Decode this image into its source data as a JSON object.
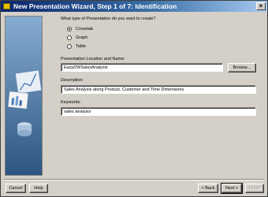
{
  "window": {
    "title": "New Presentation Wizard, Step 1 of 7: Identification",
    "close_label": "×"
  },
  "question": "What type of Presentation do you want to create?",
  "options": [
    {
      "label": "Crosstab",
      "checked": true
    },
    {
      "label": "Graph",
      "checked": false
    },
    {
      "label": "Table",
      "checked": false
    }
  ],
  "location": {
    "label": "Presentation Location and Name:",
    "value": "EasyDWSalesAnalysis",
    "browse_label": "Browse..."
  },
  "description": {
    "label": "Description:",
    "value": "Sales Analysis along  Product, Customer and Time Dimensions"
  },
  "keywords": {
    "label": "Keywords:",
    "value": "sales analysis"
  },
  "footer": {
    "cancel": "Cancel",
    "help": "Help",
    "back": "< Back",
    "next": "Next >",
    "finish": "Finish"
  }
}
